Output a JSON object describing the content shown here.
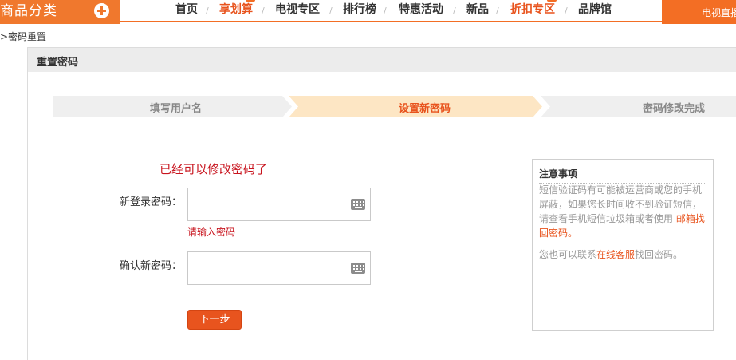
{
  "top_nav": {
    "category_label": "商品分类",
    "items": [
      {
        "label": "首页",
        "hot": false
      },
      {
        "label": "享划算",
        "hot": true
      },
      {
        "label": "电视专区",
        "hot": false
      },
      {
        "label": "排行榜",
        "hot": false
      },
      {
        "label": "特惠活动",
        "hot": false
      },
      {
        "label": "新品",
        "hot": false
      },
      {
        "label": "折扣专区",
        "hot": true
      },
      {
        "label": "品牌馆",
        "hot": false
      }
    ],
    "right_label": "电视直播"
  },
  "breadcrumb": ">密码重置",
  "panel": {
    "title": "重置密码",
    "steps": [
      {
        "label": "填写用户名",
        "active": false
      },
      {
        "label": "设置新密码",
        "active": true
      },
      {
        "label": "密码修改完成",
        "active": false
      }
    ]
  },
  "form": {
    "success_message": "已经可以修改密码了",
    "new_password_label": "新登录密码：",
    "new_password_value": "",
    "new_password_error": "请输入密码",
    "confirm_password_label": "确认新密码：",
    "confirm_password_value": "",
    "next_button": "下一步"
  },
  "notice": {
    "title": "注意事项",
    "body_text": "短信验证码有可能被运营商或您的手机屏蔽，如果您长时间收不到验证短信，请查看手机短信垃圾箱或者使用 ",
    "body_link": "邮箱找回密码。",
    "extra_prefix": "您也可以联系",
    "extra_link": "在线客服",
    "extra_suffix": "找回密码。"
  },
  "colors": {
    "brand_orange": "#f36e24",
    "accent_red": "#c8141e",
    "step_active_bg": "#fde6c4",
    "step_inactive_bg": "#efefef"
  }
}
